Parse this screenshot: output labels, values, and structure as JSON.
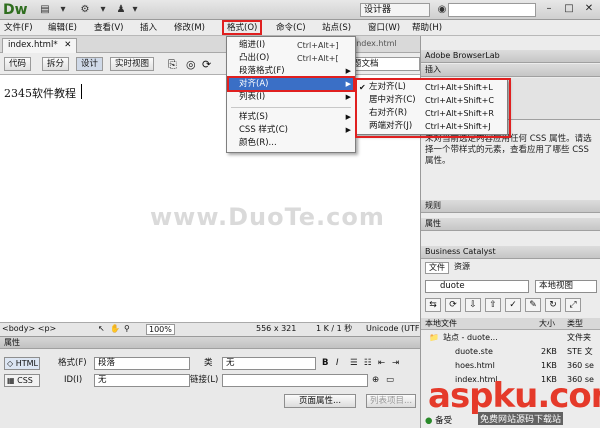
{
  "app": {
    "logo": "Dw",
    "workspace": "设计器",
    "search_placeholder": ""
  },
  "menubar": {
    "items": [
      "文件(F)",
      "编辑(E)",
      "查看(V)",
      "插入",
      "修改(M)",
      "格式(O)",
      "命令(C)",
      "站点(S)",
      "窗口(W)",
      "帮助(H)"
    ]
  },
  "document": {
    "tab": "index.html*",
    "tab2": "index.html",
    "view_buttons": [
      "代码",
      "拆分",
      "设计",
      "实时视图"
    ],
    "title_field": "无标题文档",
    "content": "2345软件教程",
    "watermark": "www.DuoTe.com"
  },
  "format_menu": {
    "items": [
      {
        "label": "缩进(I)",
        "shortcut": "Ctrl+Alt+]"
      },
      {
        "label": "凸出(O)",
        "shortcut": "Ctrl+Alt+["
      },
      {
        "label": "段落格式(F)",
        "shortcut": ""
      },
      {
        "label": "对齐(A)",
        "shortcut": ""
      },
      {
        "label": "列表(I)",
        "shortcut": ""
      },
      {
        "label": "样式(S)",
        "shortcut": ""
      },
      {
        "label": "CSS 样式(C)",
        "shortcut": ""
      },
      {
        "label": "颜色(R)...",
        "shortcut": ""
      }
    ]
  },
  "align_menu": {
    "items": [
      {
        "label": "左对齐(L)",
        "shortcut": "Ctrl+Alt+Shift+L",
        "checked": true
      },
      {
        "label": "居中对齐(C)",
        "shortcut": "Ctrl+Alt+Shift+C",
        "checked": false
      },
      {
        "label": "右对齐(R)",
        "shortcut": "Ctrl+Alt+Shift+R",
        "checked": false
      },
      {
        "label": "两端对齐(J)",
        "shortcut": "Ctrl+Alt+Shift+J",
        "checked": false
      }
    ]
  },
  "statusbar": {
    "tags": "<body> <p>",
    "zoom": "100%",
    "size": "556 x 321",
    "weight": "1 K / 1 秒",
    "encoding": "Unicode (UTF"
  },
  "properties": {
    "header": "属性",
    "html_toggle": "HTML",
    "css_toggle": "CSS",
    "format_label": "格式(F)",
    "format_value": "段落",
    "class_label": "类",
    "class_value": "无",
    "id_label": "ID(I)",
    "id_value": "无",
    "link_label": "链接(L)",
    "page_props": "页面属性...",
    "list_items": "列表项目..."
  },
  "right": {
    "browserlab": "Adobe BrowserLab",
    "insert": "插入",
    "css_info": "未对当前选定内容应用任何 CSS 属性。请选择一个带样式的元素，查看应用了哪些 CSS 属性。",
    "rules": "规则",
    "attributes": "属性",
    "business_catalyst": "Business Catalyst",
    "files_tab": "文件",
    "assets_tab": "资源",
    "site_name": "duote",
    "view_mode": "本地视图",
    "col_local": "本地文件",
    "col_size": "大小",
    "col_type": "类型",
    "files": [
      {
        "name": "站点 - duote...",
        "size": "",
        "type": "文件夹"
      },
      {
        "name": "duote.ste",
        "size": "2KB",
        "type": "STE 文"
      },
      {
        "name": "hoes.html",
        "size": "1KB",
        "type": "360 se"
      },
      {
        "name": "index.html",
        "size": "1KB",
        "type": "360 se"
      }
    ],
    "log": "备受"
  },
  "brand": {
    "name": "aspku.com",
    "sub": "免费网站源码下载站"
  }
}
